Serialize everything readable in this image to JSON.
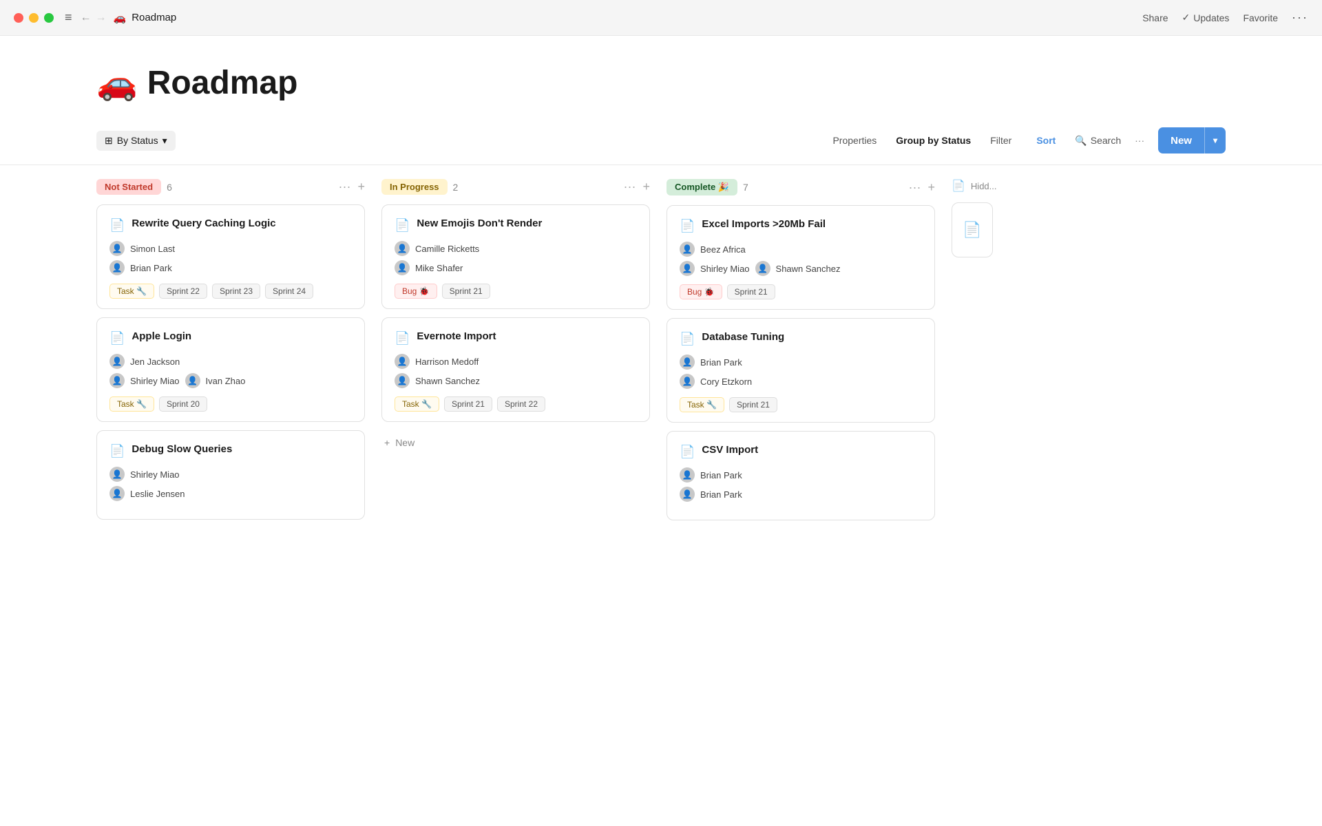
{
  "titlebar": {
    "title": "Roadmap",
    "emoji": "🚗",
    "actions": {
      "share": "Share",
      "updates": "Updates",
      "favorite": "Favorite",
      "more": "···"
    }
  },
  "page": {
    "title": "Roadmap",
    "emoji": "🚗"
  },
  "toolbar": {
    "view_label": "By Status",
    "properties": "Properties",
    "group_by_prefix": "Group by",
    "group_by_value": "Status",
    "filter": "Filter",
    "sort": "Sort",
    "search": "Search",
    "more": "···",
    "new_button": "New"
  },
  "columns": [
    {
      "id": "not-started",
      "label": "Not Started",
      "count": 6,
      "cards": [
        {
          "title": "Rewrite Query Caching Logic",
          "assignees": [
            "Simon Last",
            "Brian Park"
          ],
          "tags": [
            "Task 🔧",
            "Sprint 22",
            "Sprint 23",
            "Sprint 24"
          ]
        },
        {
          "title": "Apple Login",
          "assignees": [
            "Jen Jackson",
            "Shirley Miao",
            "Ivan Zhao"
          ],
          "tags": [
            "Task 🔧",
            "Sprint 20"
          ]
        },
        {
          "title": "Debug Slow Queries",
          "assignees": [
            "Shirley Miao",
            "Leslie Jensen"
          ],
          "tags": []
        }
      ]
    },
    {
      "id": "in-progress",
      "label": "In Progress",
      "count": 2,
      "cards": [
        {
          "title": "New Emojis Don't Render",
          "assignees": [
            "Camille Ricketts",
            "Mike Shafer"
          ],
          "tags": [
            "Bug 🐞",
            "Sprint 21"
          ]
        },
        {
          "title": "Evernote Import",
          "assignees": [
            "Harrison Medoff",
            "Shawn Sanchez"
          ],
          "tags": [
            "Task 🔧",
            "Sprint 21",
            "Sprint 22"
          ]
        }
      ],
      "show_new": true
    },
    {
      "id": "complete",
      "label": "Complete 🎉",
      "count": 7,
      "cards": [
        {
          "title": "Excel Imports >20Mb Fail",
          "assignees": [
            "Beez Africa",
            "Shirley Miao",
            "Shawn Sanchez"
          ],
          "tags": [
            "Bug 🐞",
            "Sprint 21"
          ]
        },
        {
          "title": "Database Tuning",
          "assignees": [
            "Brian Park",
            "Cory Etzkorn"
          ],
          "tags": [
            "Task 🔧",
            "Sprint 21"
          ]
        },
        {
          "title": "CSV Import",
          "assignees": [
            "Brian Park",
            "Brian Park"
          ],
          "tags": []
        }
      ]
    },
    {
      "id": "hidden",
      "label": "Hidd...",
      "partial": true
    }
  ],
  "icons": {
    "doc": "📄",
    "search": "🔍",
    "plus": "+",
    "dots": "···",
    "chevron_down": "▾",
    "check": "✓",
    "grid": "⊞",
    "back": "←",
    "forward": "→"
  }
}
